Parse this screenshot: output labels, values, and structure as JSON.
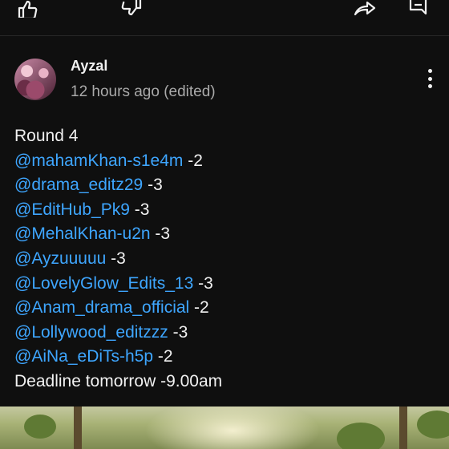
{
  "post": {
    "author": "Ayzal",
    "meta": "12 hours ago (edited)",
    "lines": [
      {
        "mention": "",
        "text": "Round 4"
      },
      {
        "mention": "@mahamKhan-s1e4m",
        "text": " -2"
      },
      {
        "mention": "@drama_editz29",
        "text": " -3"
      },
      {
        "mention": "@EditHub_Pk9",
        "text": " -3"
      },
      {
        "mention": "@MehalKhan-u2n",
        "text": " -3"
      },
      {
        "mention": "@Ayzuuuuu",
        "text": " -3"
      },
      {
        "mention": "@LovelyGlow_Edits_13",
        "text": " -3"
      },
      {
        "mention": "@Anam_drama_official",
        "text": " -2"
      },
      {
        "mention": "@Lollywood_editzzz",
        "text": " -3"
      },
      {
        "mention": "@AiNa_eDiTs-h5p",
        "text": " -2"
      },
      {
        "mention": "",
        "text": "Deadline tomorrow -9.00am"
      }
    ]
  },
  "icons": {
    "like": "thumbs-up-icon",
    "dislike": "thumbs-down-icon",
    "share": "share-icon",
    "comment": "comment-icon",
    "more": "more-vert-icon"
  },
  "colors": {
    "background": "#0f0f0f",
    "text": "#f1f1f1",
    "secondary": "#aaaaaa",
    "link": "#3ea6ff"
  }
}
